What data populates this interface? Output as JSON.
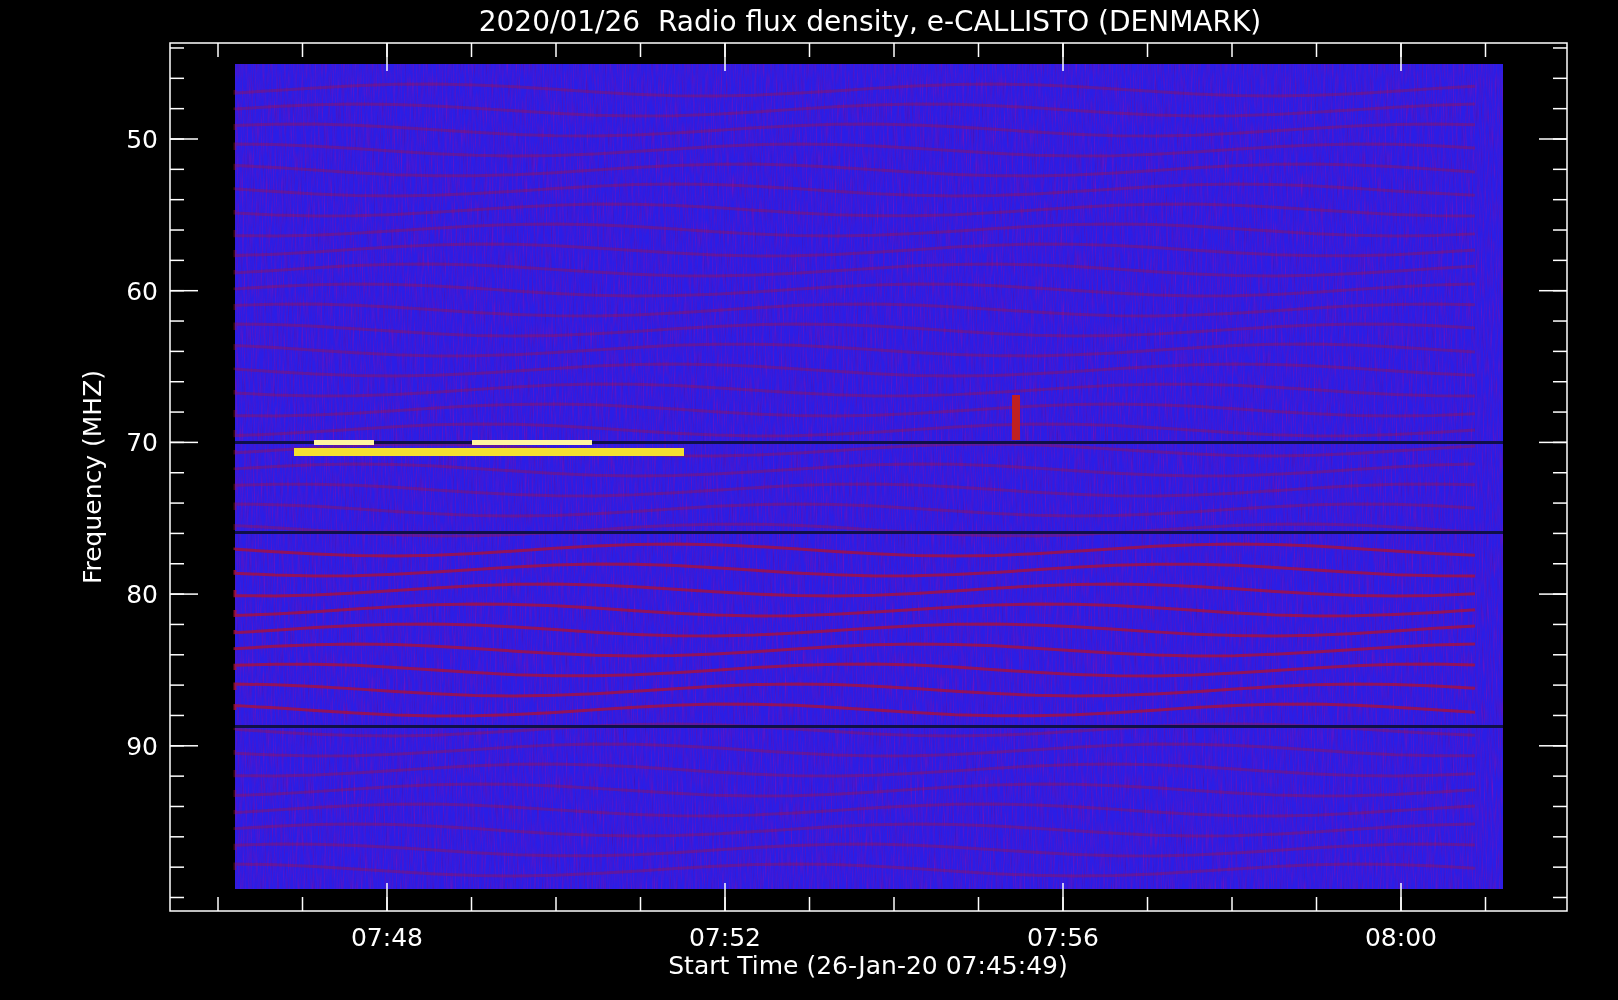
{
  "title": "2020/01/26  Radio flux density, e-CALLISTO (DENMARK)",
  "ylabel": "Frequency (MHZ)",
  "xlabel": "Start Time (26-Jan-20 07:45:49)",
  "yticks": [
    "50",
    "60",
    "70",
    "80",
    "90"
  ],
  "xticks": [
    "07:48",
    "07:52",
    "07:56",
    "08:00"
  ]
}
